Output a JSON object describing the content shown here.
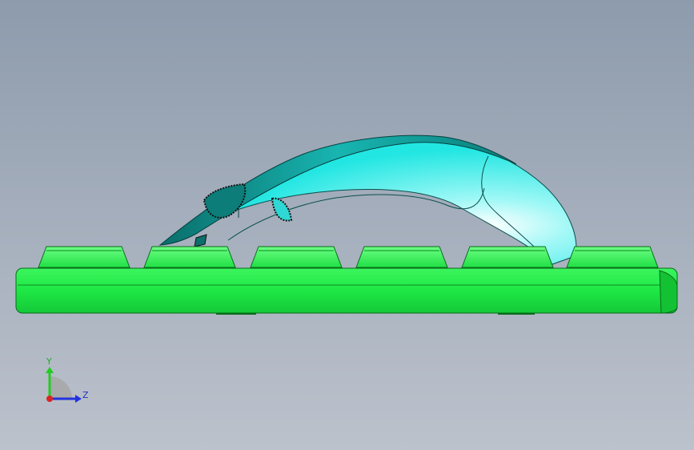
{
  "viewport": {
    "background_top": "#8d9bac",
    "background_bottom": "#bcc2cc"
  },
  "model": {
    "keyboard_color": "#1ef04a",
    "keyboard_dark": "#0a8a22",
    "mouse_color": "#2ff0ee",
    "mouse_dark": "#0b8f8c"
  },
  "triad": {
    "y_label": "Y",
    "z_label": "Z",
    "y_color": "#22cc22",
    "z_color": "#2233dd",
    "x_color": "#dd2222"
  }
}
